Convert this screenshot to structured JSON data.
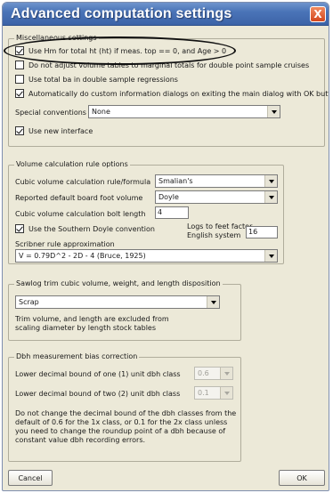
{
  "window": {
    "title": "Advanced computation settings",
    "close_label": "X"
  },
  "misc": {
    "group_label": "Miscellaneous settings",
    "use_hm": {
      "label": "Use Hm for total ht (ht) if meas. top == 0, and Age > 0",
      "checked": true
    },
    "no_adjust": {
      "label": "Do not adjust volume tables to marginal totals for double point sample cruises",
      "checked": false
    },
    "use_total_ba": {
      "label": "Use total ba in double sample regressions",
      "checked": false
    },
    "auto_custom": {
      "label": "Automatically do custom information dialogs on exiting the main dialog with OK button",
      "checked": true
    },
    "special_conventions_label": "Special conventions",
    "special_conventions_value": "None",
    "new_interface": {
      "label": "Use new interface",
      "checked": true
    }
  },
  "volume": {
    "group_label": "Volume calculation rule options",
    "cubic_rule_label": "Cubic volume calculation rule/formula",
    "cubic_rule_value": "Smalian's",
    "board_foot_label": "Reported default board foot volume",
    "board_foot_value": "Doyle",
    "bolt_length_label": "Cubic volume calculation bolt length",
    "bolt_length_value": "4",
    "southern_doyle": {
      "label": "Use the Southern Doyle convention",
      "checked": true
    },
    "logs_factor_label_1": "Logs to feet factor",
    "logs_factor_label_2": "English system",
    "logs_factor_value": "16",
    "scribner_label": "Scribner rule approximation",
    "scribner_value": "V = 0.79D^2 - 2D - 4 (Bruce, 1925)"
  },
  "sawlog": {
    "group_label": "Sawlog trim cubic volume, weight, and length disposition",
    "disposition_value": "Scrap",
    "note_1": "Trim volume, and length are excluded from",
    "note_2": "scaling diameter by length stock tables"
  },
  "dbh": {
    "group_label": "Dbh measurement bias correction",
    "one_unit_label": "Lower decimal bound of one (1) unit dbh class",
    "one_unit_value": "0.6",
    "two_unit_label": "Lower decimal bound of two (2) unit dbh class",
    "two_unit_value": "0.1",
    "note_1": "Do not change the decimal bound of the dbh classes from the",
    "note_2": "default of 0.6 for the 1x class, or 0.1 for the 2x class unless",
    "note_3": "you need to change the roundup point of a dbh because of",
    "note_4": "constant value dbh recording errors."
  },
  "footer": {
    "cancel_label": "Cancel",
    "ok_label": "OK"
  }
}
